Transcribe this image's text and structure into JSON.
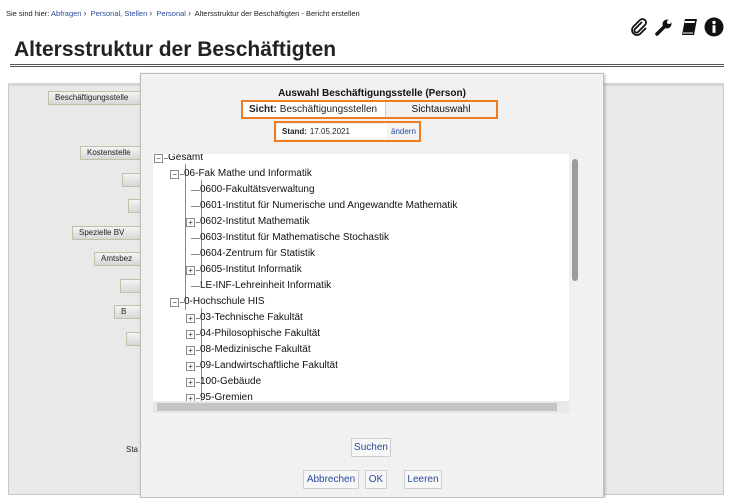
{
  "breadcrumb": {
    "prefix": "Sie sind hier:",
    "items": [
      "Abfragen",
      "Personal, Stellen",
      "Personal"
    ],
    "current": "Altersstruktur der Beschäftigten - Bericht erstellen"
  },
  "page_title": "Altersstruktur der Beschäftigten",
  "toolbar_icons": [
    "paperclip-icon",
    "wrench-icon",
    "book-icon",
    "info-icon"
  ],
  "background_form": {
    "buttons": [
      "Beschäftigungsstelle",
      "Kostenstelle",
      "",
      "",
      "Spezielle BV",
      "Amtsbez",
      "",
      "B",
      ""
    ],
    "labels": [
      "Sta"
    ]
  },
  "dialog": {
    "title": "Auswahl Beschäftigungsstelle (Person)",
    "view_label": "Sicht:",
    "view_value": "Beschäftigungsstellen",
    "view_button": "Sichtauswahl",
    "date_label": "Stand:",
    "date_value": "17.05.2021",
    "change_link": "ändern",
    "tree": [
      {
        "label": "Gesamt",
        "level": 0,
        "expandable": true,
        "expanded": true
      },
      {
        "label": "06-Fak Mathe und Informatik",
        "level": 1,
        "expandable": true,
        "expanded": true
      },
      {
        "label": "0600-Fakultätsverwaltung",
        "level": 2,
        "expandable": false
      },
      {
        "label": "0601-Institut für Numerische und Angewandte Mathematik",
        "level": 2,
        "expandable": false
      },
      {
        "label": "0602-Institut Mathematik",
        "level": 2,
        "expandable": true,
        "expanded": false
      },
      {
        "label": "0603-Institut für Mathematische Stochastik",
        "level": 2,
        "expandable": false
      },
      {
        "label": "0604-Zentrum für Statistik",
        "level": 2,
        "expandable": false
      },
      {
        "label": "0605-Institut Informatik",
        "level": 2,
        "expandable": true,
        "expanded": false
      },
      {
        "label": "LE-INF-Lehreinheit Informatik",
        "level": 2,
        "expandable": false
      },
      {
        "label": "0-Hochschule HIS",
        "level": 1,
        "expandable": true,
        "expanded": true
      },
      {
        "label": "03-Technische Fakultät",
        "level": 2,
        "expandable": true,
        "expanded": false
      },
      {
        "label": "04-Philosophische Fakultät",
        "level": 2,
        "expandable": true,
        "expanded": false
      },
      {
        "label": "08-Medizinische Fakultät",
        "level": 2,
        "expandable": true,
        "expanded": false
      },
      {
        "label": "09-Landwirtschaftliche Fakultät",
        "level": 2,
        "expandable": true,
        "expanded": false
      },
      {
        "label": "100-Gebäude",
        "level": 2,
        "expandable": true,
        "expanded": false
      },
      {
        "label": "95-Gremien",
        "level": 2,
        "expandable": true,
        "expanded": false
      }
    ],
    "search_button": "Suchen",
    "cancel_button": "Abbrechen",
    "ok_button": "OK",
    "clear_button": "Leeren"
  },
  "colors": {
    "highlight": "#ef7d20",
    "link": "#2b4b9b"
  }
}
